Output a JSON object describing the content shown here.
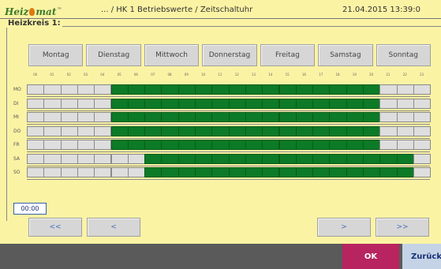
{
  "header": {
    "logo_text_left": "Heiz",
    "logo_text_right": "mat",
    "logo_tm": "™",
    "title": "... / HK 1 Betriebswerte / Zeitschaltuhr",
    "datetime": "21.04.2015 13:39:0"
  },
  "section": {
    "title": "Heizkreis 1:"
  },
  "days": [
    "Montag",
    "Dienstag",
    "Mittwoch",
    "Donnerstag",
    "Freitag",
    "Samstag",
    "Sonntag"
  ],
  "hour_ticks": [
    "00",
    "01",
    "02",
    "03",
    "04",
    "05",
    "06",
    "07",
    "08",
    "09",
    "10",
    "11",
    "12",
    "13",
    "14",
    "15",
    "16",
    "17",
    "18",
    "19",
    "20",
    "21",
    "22",
    "23"
  ],
  "schedule": {
    "rows": [
      {
        "label": "MO",
        "on": [
          [
            5,
            21
          ]
        ]
      },
      {
        "label": "DI",
        "on": [
          [
            5,
            21
          ]
        ]
      },
      {
        "label": "MI",
        "on": [
          [
            5,
            21
          ]
        ]
      },
      {
        "label": "DO",
        "on": [
          [
            5,
            21
          ]
        ]
      },
      {
        "label": "FR",
        "on": [
          [
            5,
            21
          ]
        ]
      },
      {
        "label": "SA",
        "on": [
          [
            7,
            23
          ]
        ]
      },
      {
        "label": "SO",
        "on": [
          [
            7,
            23
          ]
        ]
      }
    ]
  },
  "time_field": {
    "value": "00:00"
  },
  "nav": {
    "first": "<<",
    "prev": "<",
    "next": ">",
    "last": ">>"
  },
  "footer": {
    "ok": "OK",
    "back": "Zurück"
  },
  "colors": {
    "background": "#fbf3a4",
    "active_slot": "#0c7a26",
    "inactive_slot": "#dedede",
    "ok_button": "#b8245f",
    "back_button": "#c5d3e6"
  }
}
